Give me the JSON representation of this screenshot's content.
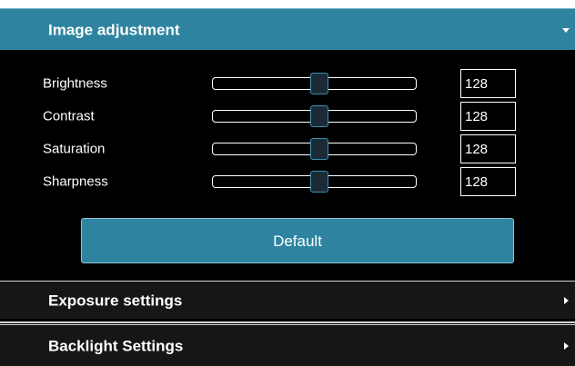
{
  "image_adjustment": {
    "title": "Image adjustment",
    "expanded": true,
    "rows": [
      {
        "label": "Brightness",
        "value": "128",
        "level": 0.5
      },
      {
        "label": "Contrast",
        "value": "128",
        "level": 0.5
      },
      {
        "label": "Saturation",
        "value": "128",
        "level": 0.5
      },
      {
        "label": "Sharpness",
        "value": "128",
        "level": 0.5
      }
    ],
    "default_button_label": "Default"
  },
  "exposure_settings": {
    "title": "Exposure settings",
    "expanded": false
  },
  "backlight_settings": {
    "title": "Backlight Settings",
    "expanded": false
  },
  "icons": {
    "expanded_caret": "caret-down-icon",
    "collapsed_caret": "caret-right-icon"
  },
  "colors": {
    "header_active": "#2e84a0",
    "header_collapsed": "#161616",
    "panel_background": "#000000",
    "text": "#ffffff",
    "thumb_border": "#3a8fb0"
  }
}
